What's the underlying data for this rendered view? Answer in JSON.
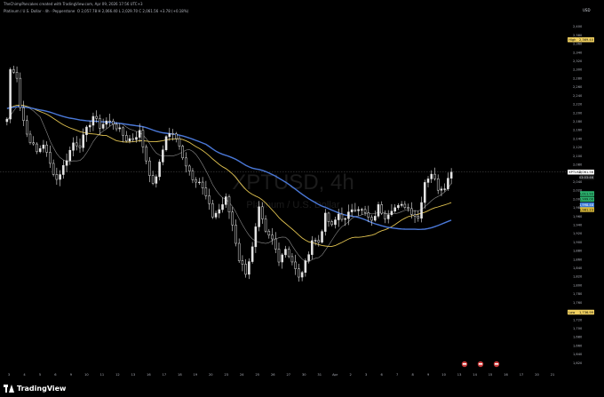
{
  "header": {
    "attribution": "TheChimpPancakes created with TradingView.com, Apr 09, 2026 17:56 UTC+3",
    "legend": "Platinum / U.S. Dollar · 4h · Pepperstone",
    "ohlc": "O 2,057.78  H 2,066.40  L 2,029.70  C 2,061.56  +3.78 (+0.18%)",
    "currency": "USD"
  },
  "brand": {
    "name": "TradingView"
  },
  "colors": {
    "background": "#000000",
    "candle": "#e6e6e6",
    "ma_short": "#8c8c8c",
    "ma_mid": "#e0c250",
    "ma_long": "#4a78d8",
    "label_high": "#f0d060",
    "label_green": "#2bb36e",
    "label_blue": "#3b7ad8",
    "label_yellow": "#d8b83a"
  },
  "chart_data": {
    "type": "candlestick",
    "watermark": {
      "symbol": "XPTUSD, 4h",
      "subtitle": "Platinum / U.S. Dollar"
    },
    "ylim": [
      1600,
      2420
    ],
    "y_ticks": [
      2400,
      2380,
      2360,
      2340,
      2320,
      2300,
      2280,
      2260,
      2240,
      2220,
      2200,
      2180,
      2160,
      2140,
      2120,
      2100,
      2080,
      2060,
      2040,
      2020,
      2000,
      1980,
      1960,
      1940,
      1920,
      1900,
      1880,
      1860,
      1840,
      1820,
      1800,
      1780,
      1760,
      1740,
      1720,
      1700,
      1680,
      1660,
      1640,
      1620
    ],
    "x_ticks": [
      "3",
      "4",
      "5",
      "6",
      "9",
      "10",
      "11",
      "12",
      "13",
      "16",
      "17",
      "18",
      "19",
      "20",
      "23",
      "24",
      "25",
      "26",
      "27",
      "30",
      "31",
      "Apr",
      "2",
      "3",
      "6",
      "7",
      "8",
      "9",
      "10",
      "13",
      "14",
      "15",
      "16",
      "17",
      "20",
      "21"
    ],
    "price_labels": [
      {
        "text": "High",
        "value": "2,369.40",
        "price": 2369,
        "style": "high"
      },
      {
        "text": "XPTUSD",
        "value": "2,061.56",
        "price": 2062,
        "style": "current"
      },
      {
        "text": "",
        "value": "03:03:46",
        "price": 2050,
        "style": "timer"
      },
      {
        "text": "",
        "value": "2,011.93",
        "price": 2012,
        "style": "green"
      },
      {
        "text": "",
        "value": "1,999.00",
        "price": 1999,
        "style": "green"
      },
      {
        "text": "",
        "value": "1,998.48",
        "price": 1986,
        "style": "blue"
      },
      {
        "text": "",
        "value": "1,981.23",
        "price": 1975,
        "style": "yellow"
      },
      {
        "text": "Low",
        "value": "1,736.99",
        "price": 1737,
        "style": "low"
      }
    ],
    "anchors": [
      [
        0,
        2185
      ],
      [
        1,
        2300
      ],
      [
        3,
        2285
      ],
      [
        4,
        2215
      ],
      [
        6,
        2150
      ],
      [
        9,
        2108
      ],
      [
        11,
        2128
      ],
      [
        13,
        2080
      ],
      [
        15,
        2045
      ],
      [
        17,
        2075
      ],
      [
        20,
        2130
      ],
      [
        22,
        2125
      ],
      [
        24,
        2160
      ],
      [
        26,
        2192
      ],
      [
        28,
        2168
      ],
      [
        30,
        2180
      ],
      [
        32,
        2176
      ],
      [
        34,
        2158
      ],
      [
        36,
        2138
      ],
      [
        38,
        2140
      ],
      [
        40,
        2155
      ],
      [
        42,
        2090
      ],
      [
        44,
        2030
      ],
      [
        46,
        2080
      ],
      [
        48,
        2148
      ],
      [
        50,
        2152
      ],
      [
        52,
        2120
      ],
      [
        54,
        2080
      ],
      [
        56,
        2050
      ],
      [
        58,
        2040
      ],
      [
        60,
        2005
      ],
      [
        62,
        1960
      ],
      [
        64,
        1975
      ],
      [
        66,
        2000
      ],
      [
        68,
        1940
      ],
      [
        70,
        1860
      ],
      [
        72,
        1830
      ],
      [
        74,
        1885
      ],
      [
        76,
        1975
      ],
      [
        78,
        1920
      ],
      [
        80,
        1905
      ],
      [
        82,
        1860
      ],
      [
        84,
        1885
      ],
      [
        86,
        1855
      ],
      [
        88,
        1815
      ],
      [
        90,
        1850
      ],
      [
        92,
        1905
      ],
      [
        94,
        1900
      ],
      [
        96,
        1960
      ],
      [
        98,
        1935
      ],
      [
        100,
        1965
      ],
      [
        102,
        1950
      ],
      [
        104,
        1978
      ],
      [
        106,
        1980
      ],
      [
        108,
        1965
      ],
      [
        110,
        1945
      ],
      [
        112,
        1982
      ],
      [
        114,
        1960
      ],
      [
        116,
        1978
      ],
      [
        118,
        1980
      ],
      [
        120,
        1985
      ],
      [
        122,
        1970
      ],
      [
        124,
        1955
      ],
      [
        126,
        2040
      ],
      [
        128,
        2060
      ],
      [
        130,
        2025
      ],
      [
        132,
        2030
      ],
      [
        134,
        2062
      ]
    ],
    "ma_periods": [
      10,
      30,
      60
    ]
  }
}
